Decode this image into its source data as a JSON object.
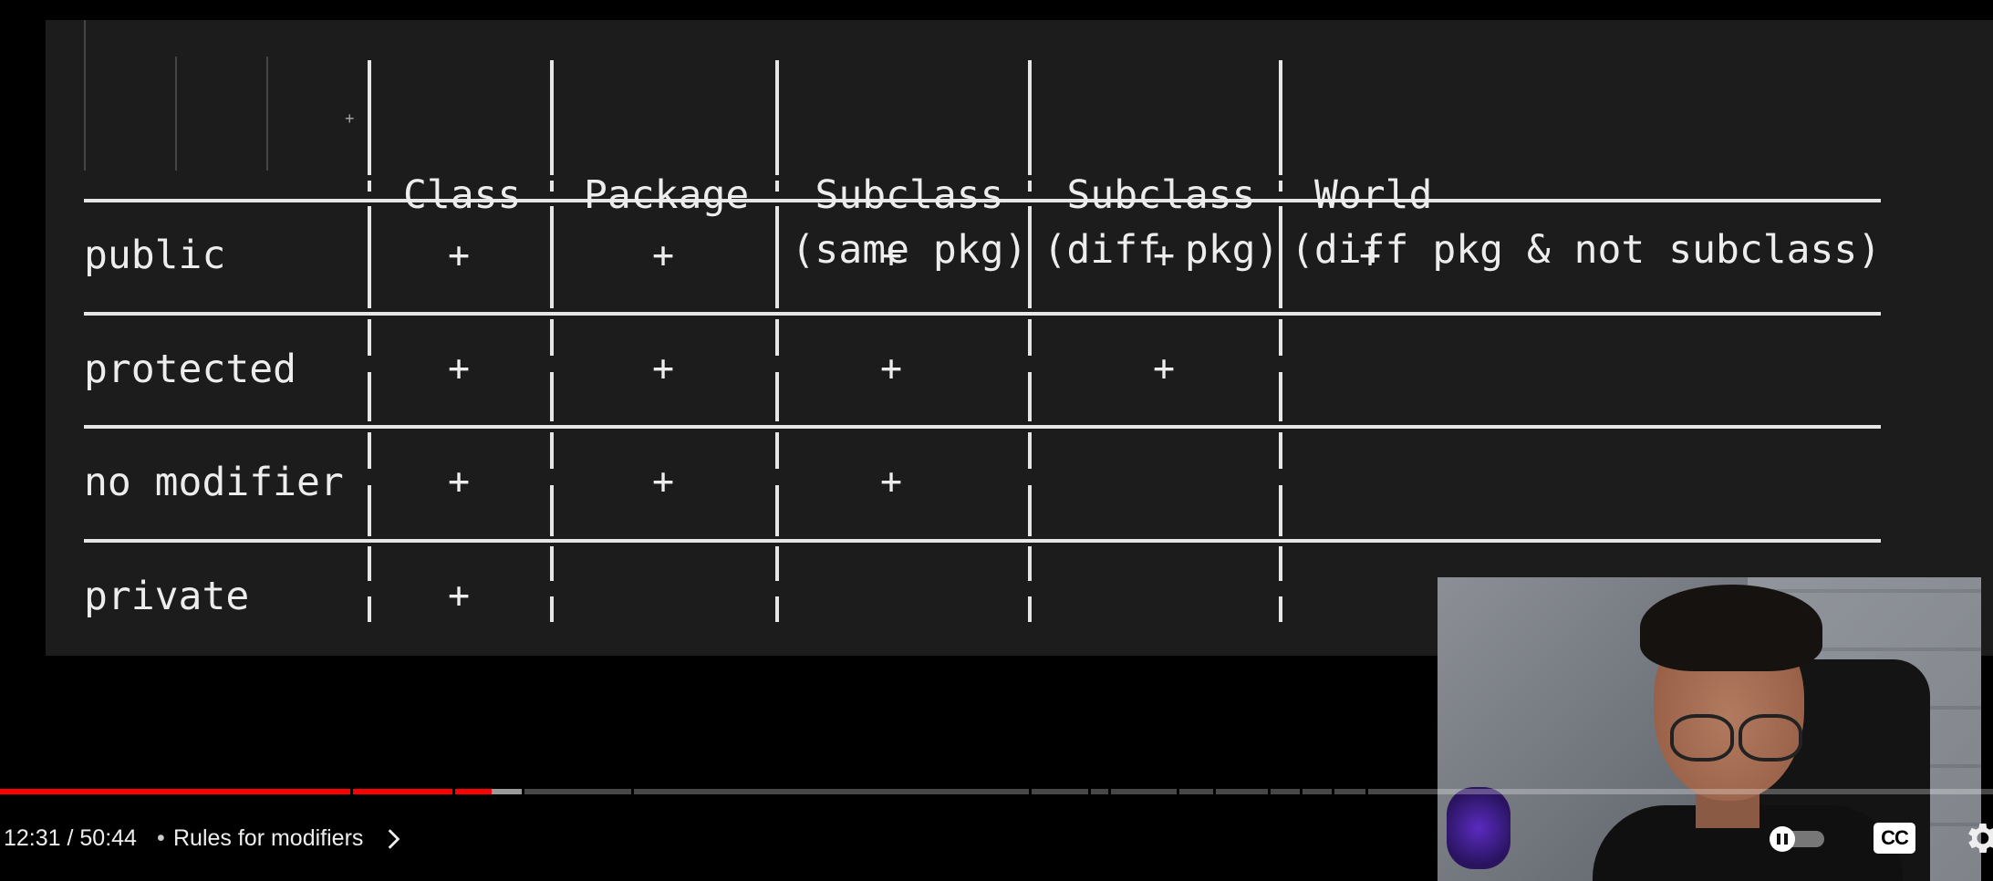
{
  "table": {
    "columns": [
      [
        "Class",
        ""
      ],
      [
        "Package",
        ""
      ],
      [
        "Subclass",
        "(same pkg)"
      ],
      [
        "Subclass",
        "(diff pkg)"
      ],
      [
        "World",
        "(diff pkg & not subclass)"
      ]
    ],
    "rows": [
      {
        "label": "public",
        "access": [
          true,
          true,
          true,
          true,
          true
        ]
      },
      {
        "label": "protected",
        "access": [
          true,
          true,
          true,
          true,
          false
        ]
      },
      {
        "label": "no modifier",
        "access": [
          true,
          true,
          true,
          false,
          false
        ]
      },
      {
        "label": "private",
        "access": [
          true,
          false,
          false,
          false,
          false
        ]
      }
    ],
    "plus_symbol": "+"
  },
  "player": {
    "time_current": "12:31",
    "time_total": "50:44",
    "time_display": "12:31 / 50:44",
    "separator": "•",
    "chapter_title": "Rules for modifiers",
    "progress_played_fraction": 0.2467,
    "progress_buffered_fraction": 0.2619,
    "cc_label": "CC",
    "colors": {
      "played": "#ff0000",
      "buffer": "#aaaaaa"
    }
  },
  "icons": {
    "chapter": "chevron-right-icon",
    "autoplay": "autoplay-toggle-icon",
    "captions": "cc-icon",
    "settings": "gear-icon"
  }
}
